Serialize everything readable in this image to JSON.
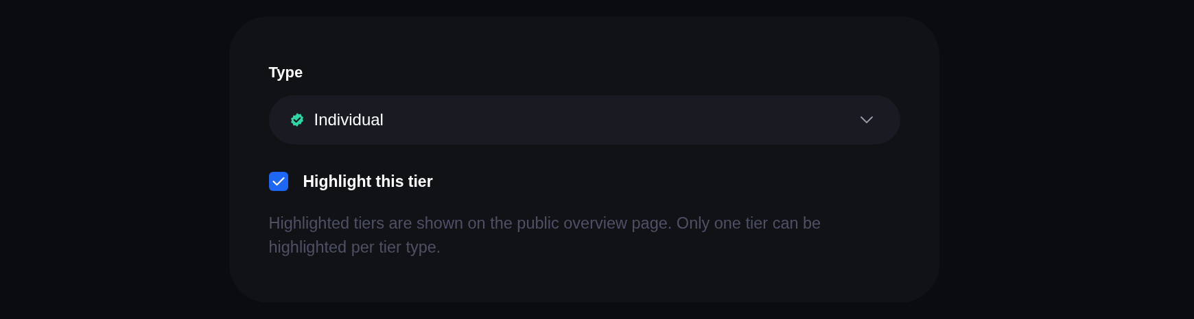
{
  "type_field": {
    "label": "Type",
    "value": "Individual"
  },
  "highlight": {
    "label": "Highlight this tier",
    "checked": true
  },
  "description": "Highlighted tiers are shown on the public overview page. Only one tier can be highlighted per tier type."
}
